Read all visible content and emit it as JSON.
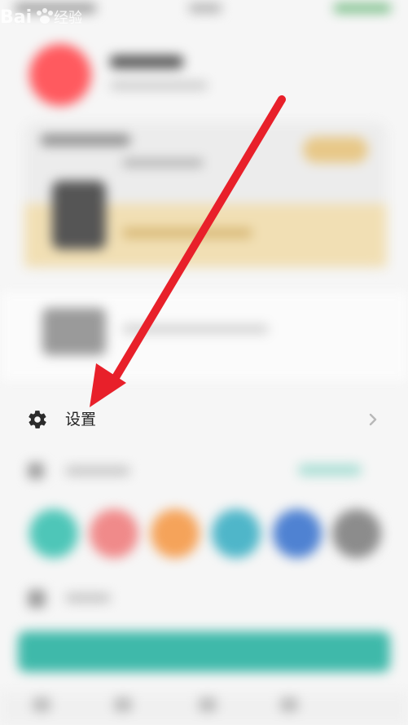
{
  "settings_row": {
    "label": "设置",
    "icon": "gear-icon",
    "chevron": "chevron-right-icon"
  },
  "annotation": {
    "arrow_color": "#e8202a"
  },
  "theme_colors": [
    "#4ec6b8",
    "#f08a8a",
    "#f5a35a",
    "#4fb6c9",
    "#4f82d2",
    "#8c8c8c"
  ],
  "accent": "#3fb9aa",
  "avatar_color": "#ff5a5f",
  "watermark": {
    "text": "Bai 经验",
    "icon": "baidu-paw-icon"
  }
}
